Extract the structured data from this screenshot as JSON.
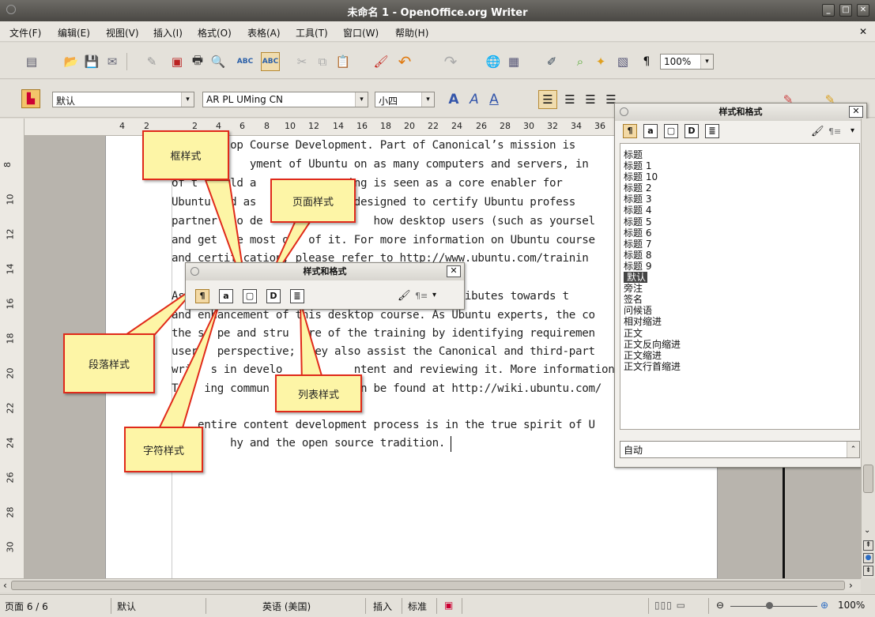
{
  "window": {
    "title": "未命名 1 - OpenOffice.org Writer"
  },
  "menu": [
    "文件(F)",
    "编辑(E)",
    "视图(V)",
    "插入(I)",
    "格式(O)",
    "表格(A)",
    "工具(T)",
    "窗口(W)",
    "帮助(H)"
  ],
  "toolbar": {
    "zoom": "100%",
    "pilcrow": "¶"
  },
  "format_bar": {
    "style_value": "默认",
    "font_value": "AR PL UMing CN",
    "size_value": "小四",
    "style_default": "默认"
  },
  "ruler": {
    "h_numbers": [
      "4",
      "2",
      "2",
      "4",
      "6",
      "8",
      "10",
      "12",
      "14",
      "16",
      "18",
      "20",
      "22",
      "24",
      "26",
      "28",
      "30",
      "32",
      "34",
      "36"
    ],
    "v_numbers": [
      "8",
      "10",
      "12",
      "14",
      "16",
      "18",
      "20",
      "22",
      "24",
      "26",
      "28",
      "30"
    ]
  },
  "document": {
    "lines": [
      "         op Course Development. Part of Canonical’s mission is",
      "            yment of Ubuntu on as many computers and servers, in",
      "of t  world a              ing is seen as a core enabler for",
      "Ubuntu  nd as               designed to certify Ubuntu profess",
      "partner  to de                 how desktop users (such as yoursel",
      "and get  he most o   of it. For more information on Ubuntu course",
      "and certification, please refer to http://www.ubuntu.com/trainin",
      "",
      "As                                      contributes towards t",
      "and enhancement of this desktop course. As Ubuntu experts, the co",
      "the sc pe and stru  ure of the training by identifying requiremen",
      "users  perspective;  hey also assist the Canonical and third-part",
      "writ  s in develo           ntent and reviewing it. More information",
      "Tra  ing commun              n be found at http://wiki.ubuntu.com/",
      "",
      "T   entire content development process is in the true spirit of U",
      "         hy and the open source tradition."
    ]
  },
  "callouts": {
    "frame": "框样式",
    "page": "页面样式",
    "paragraph": "段落样式",
    "list": "列表样式",
    "character": "字符样式"
  },
  "floating_panel": {
    "title": "样式和格式"
  },
  "styles_panel": {
    "title": "样式和格式",
    "items": [
      "标题",
      "标题 1",
      "标题 10",
      "标题 2",
      "标题 3",
      "标题 4",
      "标题 5",
      "标题 6",
      "标题 7",
      "标题 8",
      "标题 9",
      "默认",
      "旁注",
      "签名",
      "问候语",
      "相对缩进",
      "正文",
      "正文反向缩进",
      "正文缩进",
      "正文行首缩进"
    ],
    "selected": "默认",
    "filter": "自动"
  },
  "status": {
    "page": "页面 6 / 6",
    "style": "默认",
    "language": "英语 (美国)",
    "insert_mode": "插入",
    "selection_mode": "标准",
    "zoom": "100%"
  }
}
